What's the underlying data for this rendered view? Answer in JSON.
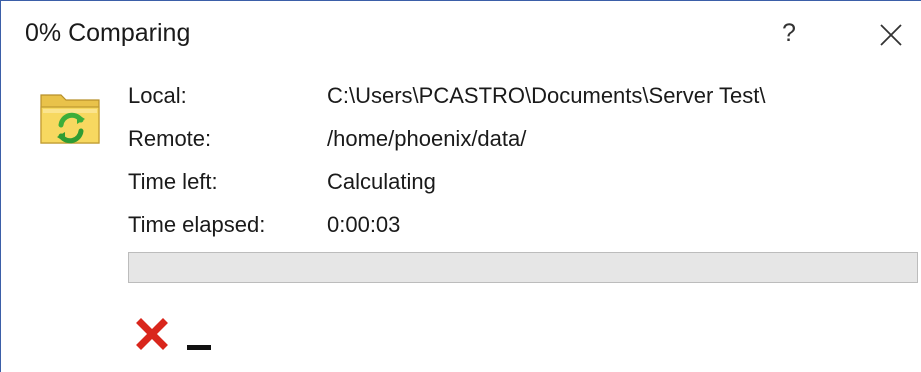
{
  "window": {
    "title": "0% Comparing",
    "help_glyph": "?",
    "close_icon": "close-icon"
  },
  "details": {
    "local_label": "Local:",
    "local_value": "C:\\Users\\PCASTRO\\Documents\\Server Test\\",
    "remote_label": "Remote:",
    "remote_value": "/home/phoenix/data/",
    "time_left_label": "Time left:",
    "time_left_value": "Calculating",
    "time_elapsed_label": "Time elapsed:",
    "time_elapsed_value": "0:00:03"
  },
  "progress": {
    "percent": 0
  },
  "actions": {
    "cancel_icon": "cancel-icon",
    "minimize_icon": "minimize-icon"
  },
  "icons": {
    "folder": "folder-sync-icon"
  },
  "colors": {
    "window_border": "#3b5fa8",
    "progress_track": "#e6e6e6",
    "progress_fill": "#06b025",
    "cancel_red": "#d9261c",
    "folder_yellow": "#f5d45a",
    "sync_green": "#3cae3a"
  }
}
